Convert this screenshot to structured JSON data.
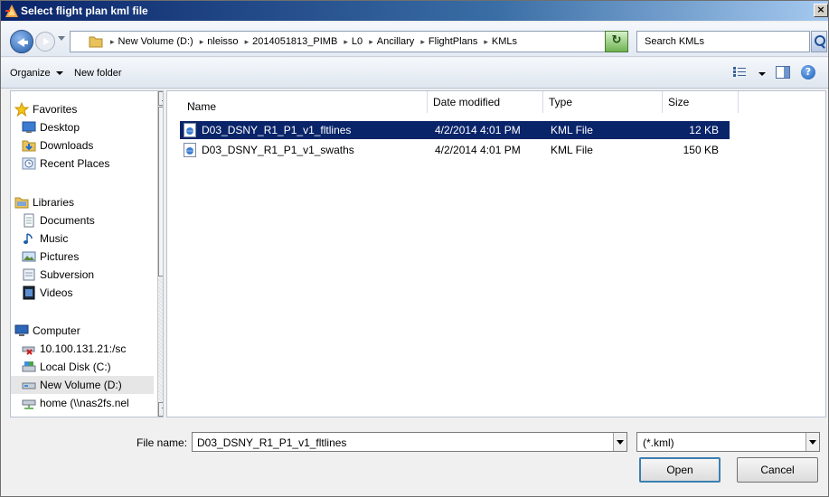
{
  "window": {
    "title": "Select flight plan kml file",
    "close_glyph": "×"
  },
  "address": {
    "crumbs": [
      "New Volume (D:)",
      "nleisso",
      "2014051813_PIMB",
      "L0",
      "Ancillary",
      "FlightPlans",
      "KMLs"
    ],
    "refresh_glyph": "↻"
  },
  "search": {
    "placeholder": "Search KMLs"
  },
  "toolbar": {
    "organize_label": "Organize",
    "new_folder_label": "New folder",
    "help_glyph": "?"
  },
  "sidebar": {
    "groups": [
      {
        "label": "Favorites",
        "icon": "star-icon",
        "items": [
          {
            "label": "Desktop",
            "icon": "desktop-icon"
          },
          {
            "label": "Downloads",
            "icon": "downloads-icon"
          },
          {
            "label": "Recent Places",
            "icon": "recent-places-icon"
          }
        ]
      },
      {
        "label": "Libraries",
        "icon": "libraries-icon",
        "items": [
          {
            "label": "Documents",
            "icon": "documents-icon"
          },
          {
            "label": "Music",
            "icon": "music-icon"
          },
          {
            "label": "Pictures",
            "icon": "pictures-icon"
          },
          {
            "label": "Subversion",
            "icon": "subversion-icon"
          },
          {
            "label": "Videos",
            "icon": "videos-icon"
          }
        ]
      },
      {
        "label": "Computer",
        "icon": "computer-icon",
        "items": [
          {
            "label": "10.100.131.21:/sc",
            "icon": "network-drive-disconnected-icon"
          },
          {
            "label": "Local Disk (C:)",
            "icon": "local-disk-icon"
          },
          {
            "label": "New Volume (D:)",
            "icon": "volume-icon",
            "selected": true
          },
          {
            "label": "home (\\\\nas2fs.nel",
            "icon": "network-drive-icon"
          }
        ]
      }
    ]
  },
  "filelist": {
    "columns": [
      "Name",
      "Date modified",
      "Type",
      "Size"
    ],
    "sort_glyph": "^",
    "rows": [
      {
        "name": "D03_DSNY_R1_P1_v1_fltlines",
        "date": "4/2/2014 4:01 PM",
        "type": "KML File",
        "size": "12 KB",
        "selected": true
      },
      {
        "name": "D03_DSNY_R1_P1_v1_swaths",
        "date": "4/2/2014 4:01 PM",
        "type": "KML File",
        "size": "150 KB",
        "selected": false
      }
    ]
  },
  "footer": {
    "file_name_label": "File name:",
    "file_name_value": "D03_DSNY_R1_P1_v1_fltlines",
    "file_type_value": "(*.kml)",
    "open_label": "Open",
    "cancel_label": "Cancel"
  },
  "colors": {
    "selection": "#0a246a",
    "title_start": "#0a246a",
    "title_end": "#a6caf0"
  }
}
